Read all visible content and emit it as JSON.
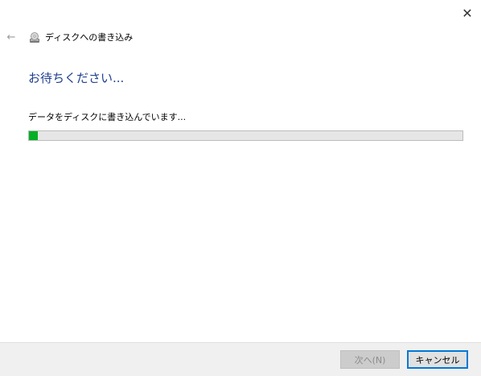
{
  "window": {
    "close_glyph": "✕"
  },
  "header": {
    "back_glyph": "←",
    "title": "ディスクへの書き込み",
    "icon": "disc-burner-icon"
  },
  "main": {
    "heading": "お待ちください...",
    "status_text": "データをディスクに書き込んでいます..."
  },
  "progress": {
    "percent": 2
  },
  "footer": {
    "next_label": "次へ(N)",
    "cancel_label": "キャンセル"
  },
  "colors": {
    "heading": "#1f3f8f",
    "progress_fill": "#06b025",
    "focus_border": "#0078d7"
  }
}
